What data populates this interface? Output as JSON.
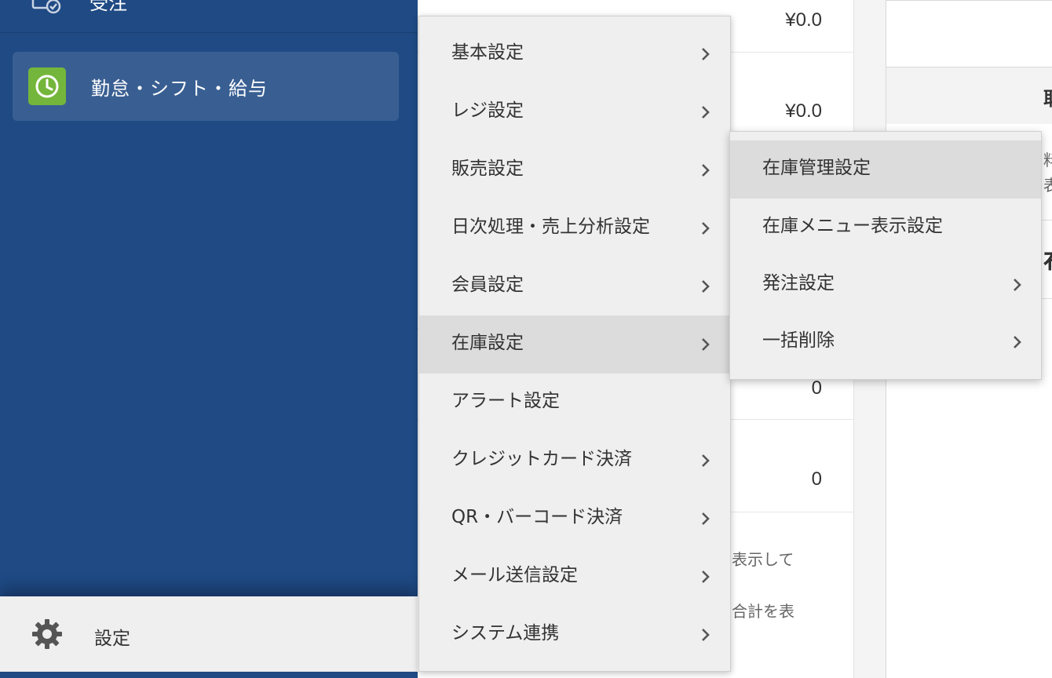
{
  "sidebar": {
    "top_item_label": "受注",
    "active_item_label": "勤怠・シフト・給与",
    "settings_label": "設定"
  },
  "background": {
    "values": [
      "¥0.0",
      "¥0.0",
      "0",
      "0"
    ],
    "notes": [
      "を表示して",
      "の合計を表"
    ],
    "right_fragments": [
      "料",
      "表",
      "布",
      "取"
    ]
  },
  "menu": {
    "items": [
      {
        "label": "基本設定",
        "has_submenu": true
      },
      {
        "label": "レジ設定",
        "has_submenu": true
      },
      {
        "label": "販売設定",
        "has_submenu": true
      },
      {
        "label": "日次処理・売上分析設定",
        "has_submenu": true
      },
      {
        "label": "会員設定",
        "has_submenu": true
      },
      {
        "label": "在庫設定",
        "has_submenu": true,
        "active": true
      },
      {
        "label": "アラート設定",
        "has_submenu": false
      },
      {
        "label": "クレジットカード決済",
        "has_submenu": true
      },
      {
        "label": "QR・バーコード決済",
        "has_submenu": true
      },
      {
        "label": "メール送信設定",
        "has_submenu": true
      },
      {
        "label": "システム連携",
        "has_submenu": true
      }
    ]
  },
  "submenu": {
    "items": [
      {
        "label": "在庫管理設定",
        "has_submenu": false,
        "hovered": true
      },
      {
        "label": "在庫メニュー表示設定",
        "has_submenu": false
      },
      {
        "label": "発注設定",
        "has_submenu": true
      },
      {
        "label": "一括削除",
        "has_submenu": true
      }
    ]
  },
  "colors": {
    "sidebar_bg": "#1f4a84",
    "sidebar_active_bg": "#395f92",
    "clock_icon_bg": "#74b63b",
    "menu_bg": "#efefef",
    "menu_active_bg": "#dcdcdc"
  }
}
